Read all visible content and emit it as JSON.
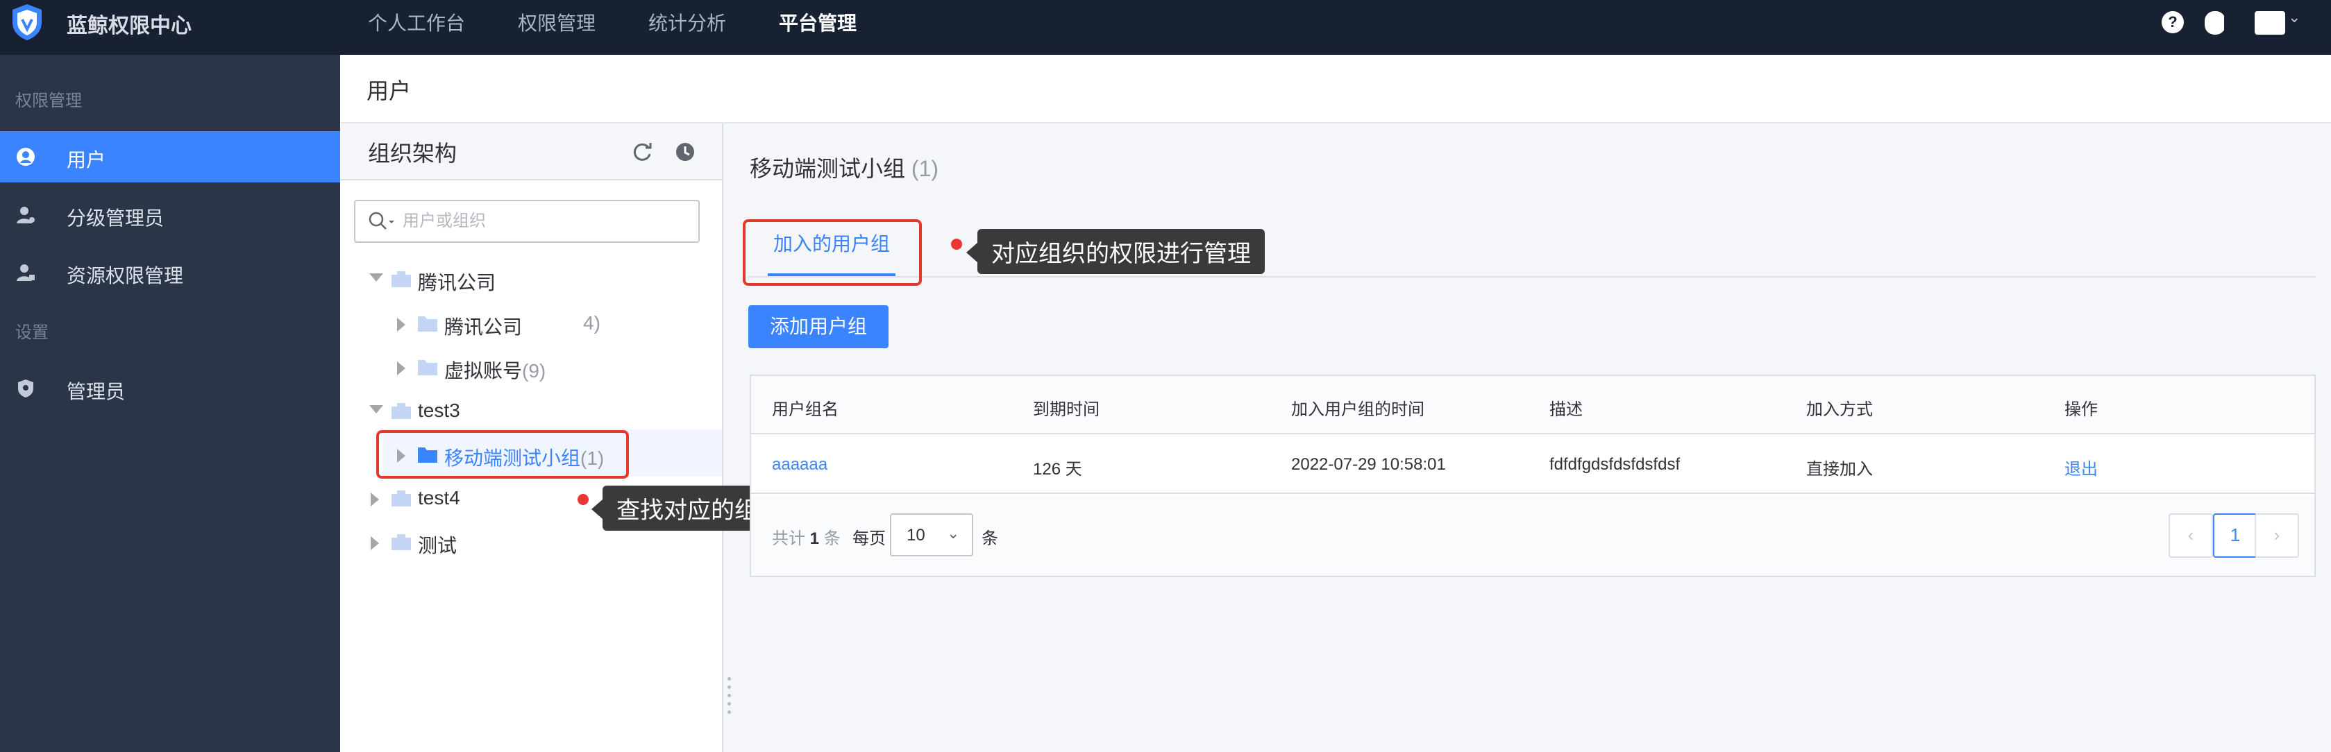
{
  "app": {
    "title": "蓝鲸权限中心"
  },
  "topnav": {
    "items": [
      {
        "label": "个人工作台"
      },
      {
        "label": "权限管理"
      },
      {
        "label": "统计分析"
      },
      {
        "label": "平台管理"
      }
    ],
    "active_index": 3,
    "help_label": "?"
  },
  "sidebar": {
    "group_permission": "权限管理",
    "group_settings": "设置",
    "items": [
      {
        "label": "用户",
        "icon": "user-circle-icon"
      },
      {
        "label": "分级管理员",
        "icon": "grade-admin-icon"
      },
      {
        "label": "资源权限管理",
        "icon": "resource-permission-icon"
      },
      {
        "label": "管理员",
        "icon": "shield-admin-icon"
      }
    ]
  },
  "page": {
    "title": "用户"
  },
  "org": {
    "title": "组织架构",
    "search_placeholder": "用户或组织",
    "tree": [
      {
        "label": "腾讯公司",
        "count": ""
      },
      {
        "label": "腾讯公司",
        "count": "4)"
      },
      {
        "label": "虚拟账号",
        "count": "(9)"
      },
      {
        "label": "test3",
        "count": ""
      },
      {
        "label": "移动端测试小组",
        "count": "(1)"
      },
      {
        "label": "test4",
        "count": ""
      },
      {
        "label": "测试",
        "count": ""
      }
    ]
  },
  "annotations": {
    "find_org": "查找对应的组织",
    "manage_perm": "对应组织的权限进行管理"
  },
  "content": {
    "title": "移动端测试小组",
    "count": "(1)",
    "tab_label": "加入的用户组",
    "add_button": "添加用户组",
    "table": {
      "columns": [
        "用户组名",
        "到期时间",
        "加入用户组的时间",
        "描述",
        "加入方式",
        "操作"
      ],
      "rows": [
        [
          "aaaaaa",
          "126 天",
          "2022-07-29 10:58:01",
          "fdfdfgdsfdsfdsfdsf",
          "直接加入",
          "退出"
        ]
      ]
    },
    "pagination": {
      "total_prefix": "共计",
      "total_count": "1",
      "total_suffix": "条",
      "per_page_label": "每页",
      "per_page_value": "10",
      "per_page_unit": "条",
      "prev": "‹",
      "current_page": "1",
      "next": "›"
    }
  },
  "colors": {
    "primary": "#3a84ff",
    "topbar": "#182132",
    "sidebar": "#2b3548",
    "annotation": "#e33a2e"
  }
}
